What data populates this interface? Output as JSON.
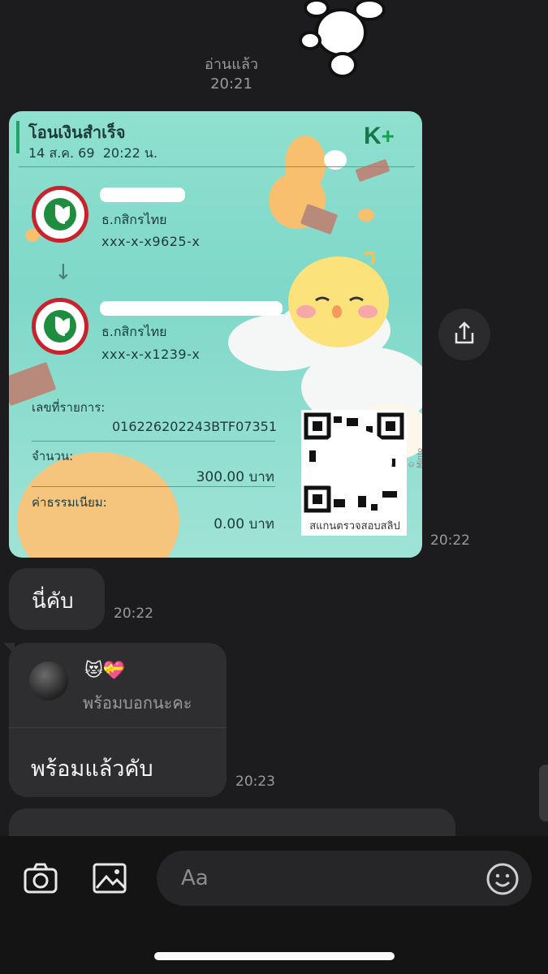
{
  "chat": {
    "read_status": "อ่านแล้ว",
    "read_time": "20:21"
  },
  "slip": {
    "title": "โอนเงินสำเร็จ",
    "date": "14 ส.ค. 69",
    "time": "20:22 น.",
    "brand": "K",
    "brand_plus": "+",
    "sender": {
      "bank": "ธ.กสิกรไทย",
      "account": "xxx-x-x9625-x"
    },
    "receiver": {
      "bank": "ธ.กสิกรไทย",
      "account": "xxx-x-x1239-x"
    },
    "arrow": "↓",
    "ref_label": "เลขที่รายการ:",
    "ref_value": "016226202243BTF07351",
    "amount_label": "จำนวน:",
    "amount_value": "300.00 บาท",
    "fee_label": "ค่าธรรมเนียม:",
    "fee_value": "0.00 บาท",
    "qr_caption": "สแกนตรวจสอบสลิป",
    "copyright": "© Minto Inc.",
    "sent_time": "20:22"
  },
  "messages": [
    {
      "text": "นี่คับ",
      "time": "20:22"
    },
    {
      "quoted_emoji": "😻💝",
      "quoted_text": "พร้อมบอกนะคะ",
      "text": "พร้อมแล้วคับ",
      "time": "20:23"
    }
  ],
  "composer": {
    "placeholder": "Aa"
  }
}
